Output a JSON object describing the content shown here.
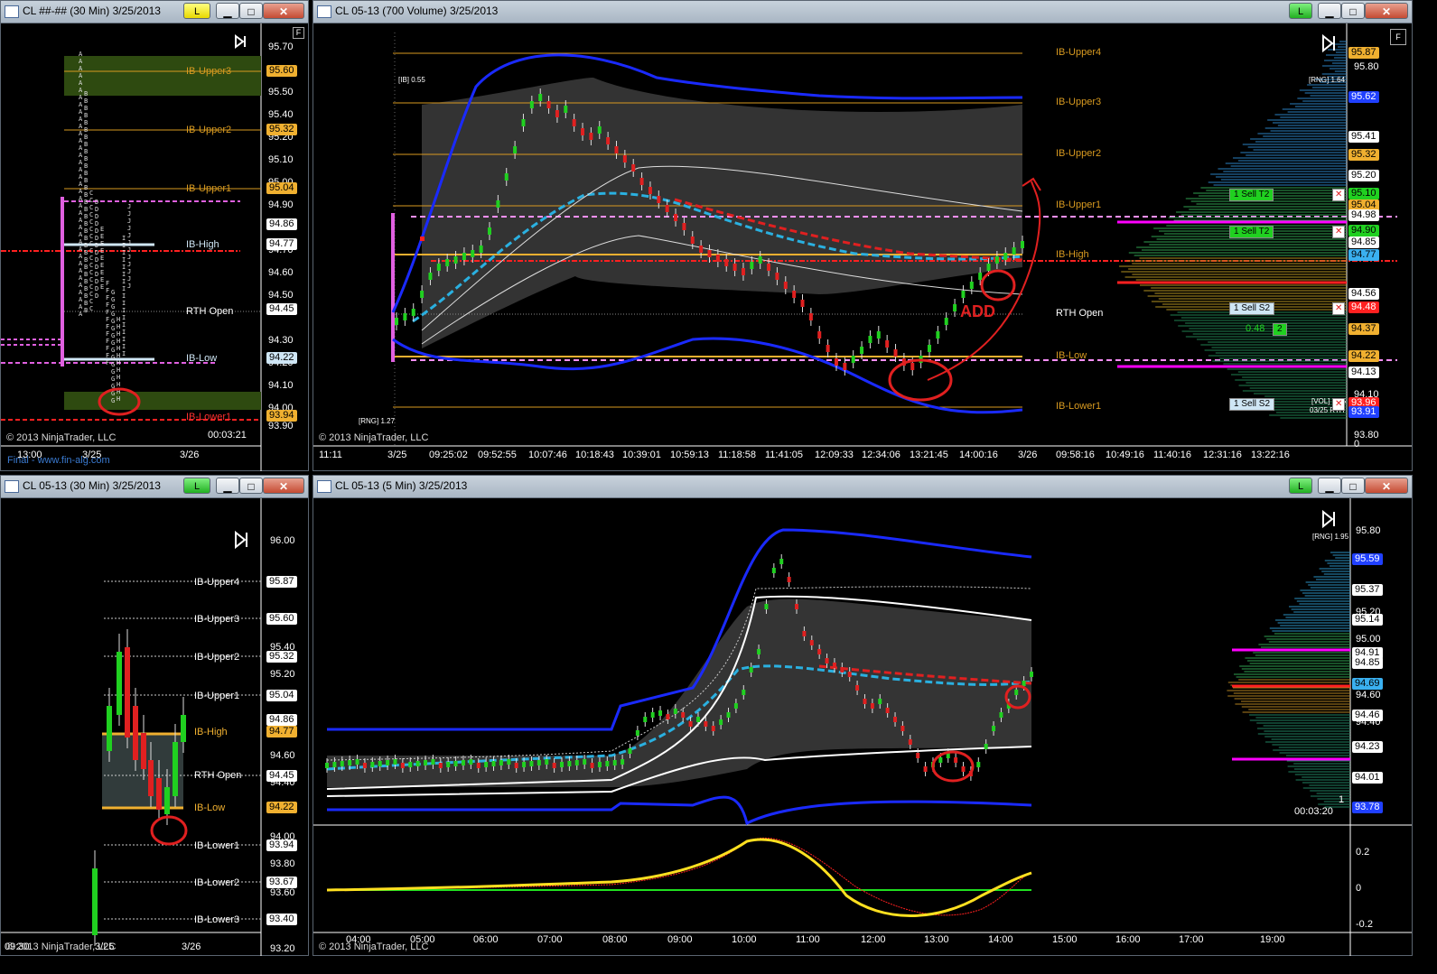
{
  "windows": {
    "top_left": {
      "title": "CL ##-## (30 Min)  3/25/2013",
      "l_button": "L"
    },
    "top_right": {
      "title": "CL 05-13 (700 Volume)  3/25/2013",
      "l_button": "L"
    },
    "bottom_left": {
      "title": "CL 05-13 (30 Min)  3/25/2013",
      "l_button": "L"
    },
    "bottom_right": {
      "title": "CL 05-13 (5 Min)  3/25/2013",
      "l_button": "L"
    }
  },
  "window_buttons": {
    "minimize": "▁",
    "maximize": "□",
    "close": "✕",
    "f_box": "F"
  },
  "copyright": "© 2013 NinjaTrader, LLC",
  "website": "Final - www.fin-alg.com",
  "tl": {
    "price_ticks": [
      "95.70",
      "95.50",
      "95.40",
      "95.20",
      "95.10",
      "95.00",
      "94.90",
      "94.70",
      "94.60",
      "94.50",
      "94.30",
      "94.20",
      "94.10",
      "94.00",
      "93.90"
    ],
    "tags": [
      {
        "v": "95.60",
        "c": "#f0b030"
      },
      {
        "v": "95.32",
        "c": "#f0b030"
      },
      {
        "v": "95.04",
        "c": "#f0b030"
      },
      {
        "v": "94.86",
        "c": "#ffffff"
      },
      {
        "v": "94.77",
        "c": "#ffffff"
      },
      {
        "v": "94.45",
        "c": "#ffffff"
      },
      {
        "v": "94.22",
        "c": "#cfe6f5"
      },
      {
        "v": "93.94",
        "c": "#f0b030"
      }
    ],
    "levels": [
      "IB-Upper3",
      "IB-Upper2",
      "IB-Upper1",
      "IB-High",
      "RTH Open",
      "IB-Low",
      "IB-Lower1"
    ],
    "x_labels": [
      "13:00",
      "3/25",
      "3/26"
    ],
    "timer": "00:03:21"
  },
  "tr": {
    "ib_label": "[IB] 0.55",
    "rng_label": "[RNG] 1.64",
    "rng_label2": "[RNG] 1.27",
    "vol_label": "[VOL] 1.95",
    "date_label": "03/25 RTH",
    "price_ticks": [
      "95.80",
      "94.60",
      "94.10",
      "94.00",
      "93.80",
      "0"
    ],
    "tags": [
      {
        "v": "95.87",
        "c": "#f0b030"
      },
      {
        "v": "95.62",
        "c": "#2040ff"
      },
      {
        "v": "95.41",
        "c": "#ffffff"
      },
      {
        "v": "95.32",
        "c": "#f0b030"
      },
      {
        "v": "95.20",
        "c": "#ffffff"
      },
      {
        "v": "95.10",
        "c": "#20d020"
      },
      {
        "v": "95.04",
        "c": "#f0b030"
      },
      {
        "v": "94.98",
        "c": "#ffffff"
      },
      {
        "v": "94.90",
        "c": "#20d020"
      },
      {
        "v": "94.85",
        "c": "#ffffff"
      },
      {
        "v": "94.77",
        "c": "#3ab0f0"
      },
      {
        "v": "94.56",
        "c": "#ffffff"
      },
      {
        "v": "94.48",
        "c": "#ff2020"
      },
      {
        "v": "94.37",
        "c": "#f0b030"
      },
      {
        "v": "94.22",
        "c": "#f0b030"
      },
      {
        "v": "94.13",
        "c": "#ffffff"
      },
      {
        "v": "93.96",
        "c": "#ff2020"
      },
      {
        "v": "93.91",
        "c": "#2040ff"
      }
    ],
    "levels": [
      "IB-Upper4",
      "IB-Upper3",
      "IB-Upper2",
      "IB-Upper1",
      "IB-High",
      "RTH Open",
      "IB-Low",
      "IB-Lower1"
    ],
    "orders": [
      {
        "qty": "1",
        "label": "Sell T2"
      },
      {
        "qty": "1",
        "label": "Sell T2"
      },
      {
        "qty": "1",
        "label": "Sell S2"
      },
      {
        "qty": "1",
        "label": "Sell S2"
      }
    ],
    "pnl": "0.48",
    "pnl_qty": "2",
    "annotation": "ADD",
    "x_labels": [
      "11:11",
      "3/25",
      "09:25:02",
      "09:52:55",
      "10:07:46",
      "10:18:43",
      "10:39:01",
      "10:59:13",
      "11:18:58",
      "11:41:05",
      "12:09:33",
      "12:34:06",
      "13:21:45",
      "14:00:16",
      "3/26",
      "09:58:16",
      "10:49:16",
      "11:40:16",
      "12:31:16",
      "13:22:16"
    ]
  },
  "bl": {
    "price_ticks": [
      "96.00",
      "95.40",
      "95.20",
      "94.60",
      "94.40",
      "94.00",
      "93.80",
      "93.60",
      "93.20"
    ],
    "tags": [
      {
        "v": "95.87",
        "c": "#ffffff"
      },
      {
        "v": "95.60",
        "c": "#ffffff"
      },
      {
        "v": "95.32",
        "c": "#ffffff"
      },
      {
        "v": "95.04",
        "c": "#ffffff"
      },
      {
        "v": "94.86",
        "c": "#ffffff"
      },
      {
        "v": "94.77",
        "c": "#f0b030"
      },
      {
        "v": "94.45",
        "c": "#ffffff"
      },
      {
        "v": "94.22",
        "c": "#f0b030"
      },
      {
        "v": "93.94",
        "c": "#ffffff"
      },
      {
        "v": "93.67",
        "c": "#ffffff"
      },
      {
        "v": "93.40",
        "c": "#ffffff"
      }
    ],
    "levels": [
      "IB-Upper4",
      "IB-Upper3",
      "IB-Upper2",
      "IB-Upper1",
      "IB-High",
      "RTH Open",
      "IB-Low",
      "IB-Lower1",
      "IB-Lower2",
      "IB-Lower3"
    ],
    "x_labels": [
      "09:30",
      "3/25",
      "3/26"
    ]
  },
  "br": {
    "rng_label": "[RNG] 1.95",
    "price_ticks": [
      "95.80",
      "95.20",
      "95.00",
      "94.80",
      "94.60",
      "94.40",
      "94.20",
      "0.2",
      "0",
      "-0.2"
    ],
    "tags": [
      {
        "v": "95.59",
        "c": "#2040ff"
      },
      {
        "v": "95.37",
        "c": "#ffffff"
      },
      {
        "v": "95.14",
        "c": "#ffffff"
      },
      {
        "v": "94.91",
        "c": "#ffffff"
      },
      {
        "v": "94.85",
        "c": "#ffffff"
      },
      {
        "v": "94.69",
        "c": "#3ab0f0"
      },
      {
        "v": "94.46",
        "c": "#ffffff"
      },
      {
        "v": "94.23",
        "c": "#ffffff"
      },
      {
        "v": "94.01",
        "c": "#ffffff"
      },
      {
        "v": "93.78",
        "c": "#2040ff"
      }
    ],
    "timer": "00:03:20",
    "count": "1",
    "x_labels": [
      "04:00",
      "05:00",
      "06:00",
      "07:00",
      "08:00",
      "09:00",
      "10:00",
      "11:00",
      "12:00",
      "13:00",
      "14:00",
      "15:00",
      "16:00",
      "17:00",
      "19:00"
    ]
  }
}
